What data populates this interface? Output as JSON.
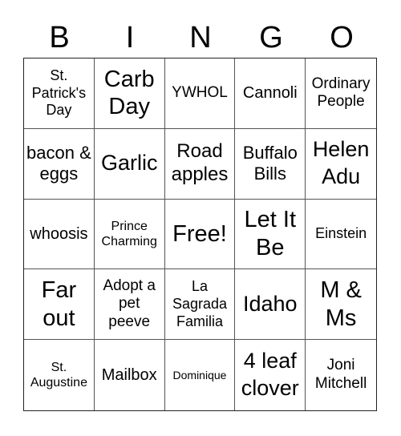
{
  "header": {
    "letters": [
      "B",
      "I",
      "N",
      "G",
      "O"
    ]
  },
  "cells": [
    "St. Patrick's Day",
    "Carb Day",
    "YWHOL",
    "Cannoli",
    "Ordinary People",
    "bacon & eggs",
    "Garlic",
    "Road apples",
    "Buffalo Bills",
    "Helen Adu",
    "whoosis",
    "Prince Charming",
    "Free!",
    "Let It Be",
    "Einstein",
    "Far out",
    "Adopt a pet peeve",
    "La Sagrada Familia",
    "Idaho",
    "M & Ms",
    "St. Augustine",
    "Mailbox",
    "Dominique",
    "4 leaf clover",
    "Joni Mitchell"
  ]
}
